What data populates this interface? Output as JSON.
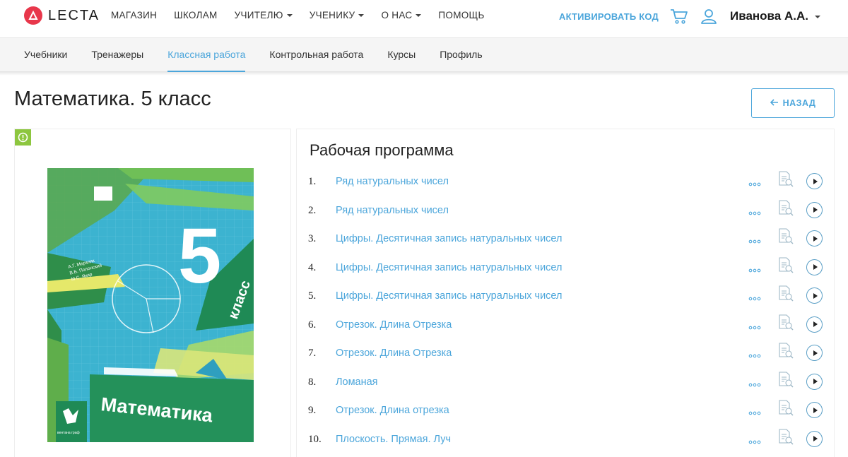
{
  "header": {
    "logo_text": "LECTA",
    "nav": [
      {
        "label": "МАГАЗИН",
        "dropdown": false
      },
      {
        "label": "ШКОЛАМ",
        "dropdown": false
      },
      {
        "label": "УЧИТЕЛЮ",
        "dropdown": true
      },
      {
        "label": "УЧЕНИКУ",
        "dropdown": true
      },
      {
        "label": "О НАС",
        "dropdown": true
      },
      {
        "label": "ПОМОЩЬ",
        "dropdown": false
      }
    ],
    "activate_label": "АКТИВИРОВАТЬ КОД",
    "user_name": "Иванова А.А."
  },
  "subnav": {
    "tabs": [
      {
        "label": "Учебники",
        "active": false
      },
      {
        "label": "Тренажеры",
        "active": false
      },
      {
        "label": "Классная работа",
        "active": true
      },
      {
        "label": "Контрольная работа",
        "active": false
      },
      {
        "label": "Курсы",
        "active": false
      },
      {
        "label": "Профиль",
        "active": false
      }
    ]
  },
  "page": {
    "title": "Математика. 5 класс",
    "back_label": "НАЗАД"
  },
  "book": {
    "cover_title": "Математика",
    "grade_number": "5",
    "grade_word": "класс",
    "authors": [
      "А.Г. Мерзляк",
      "В.Б. Полонский",
      "М.С. Якир"
    ],
    "publisher": "вентана граф"
  },
  "program": {
    "title": "Рабочая программа",
    "lessons": [
      {
        "num": "1.",
        "title": "Ряд натуральных чисел"
      },
      {
        "num": "2.",
        "title": "Ряд натуральных чисел"
      },
      {
        "num": "3.",
        "title": "Цифры. Десятичная запись натуральных чисел"
      },
      {
        "num": "4.",
        "title": "Цифры. Десятичная запись натуральных чисел"
      },
      {
        "num": "5.",
        "title": "Цифры. Десятичная запись натуральных чисел"
      },
      {
        "num": "6.",
        "title": "Отрезок. Длина Отрезка"
      },
      {
        "num": "7.",
        "title": "Отрезок. Длина Отрезка"
      },
      {
        "num": "8.",
        "title": "Ломаная"
      },
      {
        "num": "9.",
        "title": "Отрезок. Длина отрезка"
      },
      {
        "num": "10.",
        "title": "Плоскость. Прямая. Луч"
      }
    ]
  },
  "icons": {
    "logo": "lecta-logo-icon",
    "cart": "cart-icon",
    "user": "user-icon",
    "back_arrow": "arrow-left-icon",
    "info": "info-icon",
    "more": "more-dots-icon",
    "document": "document-search-icon",
    "play": "play-icon"
  },
  "colors": {
    "accent": "#4ca6db",
    "logo_red": "#e8374b",
    "info_green": "#8dc63f"
  }
}
